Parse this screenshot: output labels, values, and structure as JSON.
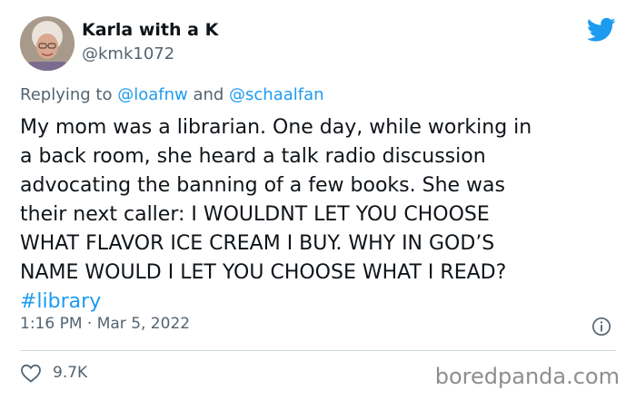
{
  "author": {
    "display_name": "Karla with a K",
    "handle": "@kmk1072"
  },
  "reply": {
    "prefix": "Replying to ",
    "mention_1": "@loafnw",
    "conjunction": " and ",
    "mention_2": "@schaalfan"
  },
  "tweet": {
    "lines": [
      "My mom was a librarian. One day, while working in",
      "a back room, she heard a talk radio discussion",
      "advocating the banning of a few books. She was",
      "their next caller: I WOULDNT LET YOU CHOOSE",
      "WHAT FLAVOR ICE CREAM I BUY. WHY IN GOD’S",
      "NAME WOULD I LET YOU CHOOSE WHAT I READ?"
    ],
    "hashtag": "#library"
  },
  "meta": {
    "timestamp": "1:16 PM · Mar 5, 2022"
  },
  "engagement": {
    "likes": "9.7K"
  },
  "watermark": "boredpanda.com",
  "colors": {
    "link": "#1d9bf0",
    "secondary_text": "#536471",
    "primary_text": "#0f1419"
  },
  "icons": {
    "brand": "twitter-bird-icon",
    "info": "info-icon",
    "like": "heart-icon"
  }
}
